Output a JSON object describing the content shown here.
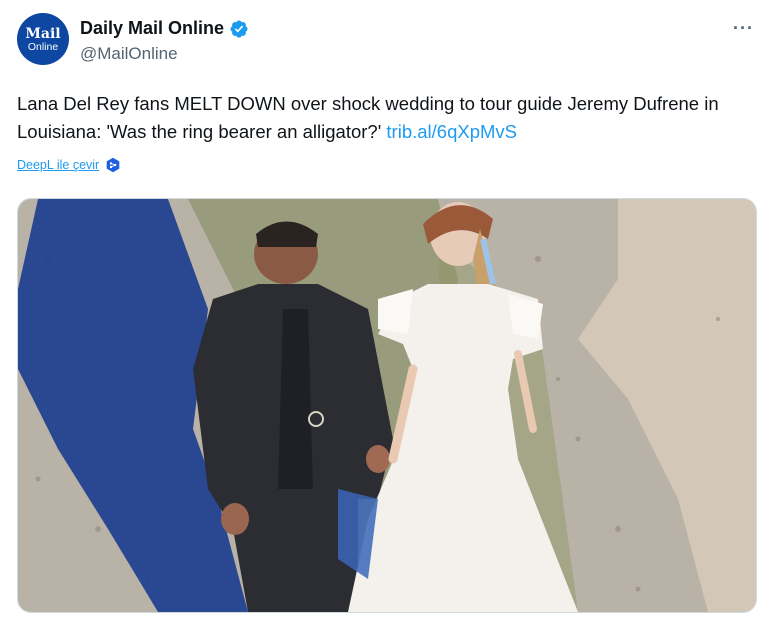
{
  "author": {
    "avatar_line1": "Mail",
    "avatar_line2": "Online",
    "display_name": "Daily Mail Online",
    "handle": "@MailOnline",
    "verified": true
  },
  "more_label": "···",
  "tweet": {
    "text": "Lana Del Rey fans MELT DOWN over shock wedding to tour guide Jeremy Dufrene in Louisiana: 'Was the ring bearer an alligator?'",
    "link": "trib.al/6qXpMvS"
  },
  "translate": {
    "label": "DeepL ile çevir",
    "icon": "deepl-icon"
  },
  "media": {
    "description_icon": "photo",
    "alt": "Aerial photo of a bride in a white gown and a groom in a dark suit walking hand in hand"
  },
  "colors": {
    "link": "#1d9bf0",
    "verified": "#1d9bf0",
    "avatar_bg": "#0d47a1",
    "muted": "#536471"
  }
}
